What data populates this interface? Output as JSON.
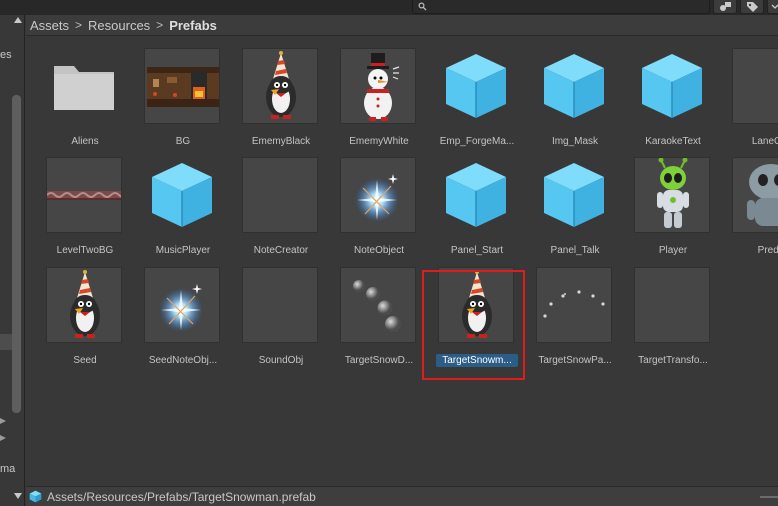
{
  "breadcrumb": {
    "items": [
      "Assets",
      "Resources",
      "Prefabs"
    ],
    "separator": ">"
  },
  "left_pane": {
    "fragments": [
      "es",
      "ma"
    ]
  },
  "assets": [
    {
      "name": "Aliens",
      "kind": "folder"
    },
    {
      "name": "BG",
      "kind": "bg-image"
    },
    {
      "name": "EmemyBlack",
      "kind": "penguin-black"
    },
    {
      "name": "EmemyWhite",
      "kind": "snowman-white"
    },
    {
      "name": "Emp_ForgeMa...",
      "kind": "prefab-cube"
    },
    {
      "name": "Img_Mask",
      "kind": "prefab-cube"
    },
    {
      "name": "KaraokeText",
      "kind": "prefab-cube"
    },
    {
      "name": "LaneCor",
      "kind": "empty"
    },
    {
      "name": "LevelTwoBG",
      "kind": "strip-image"
    },
    {
      "name": "MusicPlayer",
      "kind": "prefab-cube"
    },
    {
      "name": "NoteCreator",
      "kind": "empty"
    },
    {
      "name": "NoteObject",
      "kind": "sparkle"
    },
    {
      "name": "Panel_Start",
      "kind": "prefab-cube"
    },
    {
      "name": "Panel_Talk",
      "kind": "prefab-cube"
    },
    {
      "name": "Player",
      "kind": "alien"
    },
    {
      "name": "Preda",
      "kind": "predator"
    },
    {
      "name": "Seed",
      "kind": "penguin-black"
    },
    {
      "name": "SeedNoteObj...",
      "kind": "sparkle"
    },
    {
      "name": "SoundObj",
      "kind": "empty"
    },
    {
      "name": "TargetSnowD...",
      "kind": "snowballs"
    },
    {
      "name": "TargetSnowm...",
      "kind": "penguin-black",
      "selected": true
    },
    {
      "name": "TargetSnowPa...",
      "kind": "dots"
    },
    {
      "name": "TargetTransfo...",
      "kind": "empty"
    }
  ],
  "status_bar": {
    "path": "Assets/Resources/Prefabs/TargetSnowman.prefab",
    "icon": "prefab-cube-icon"
  },
  "colors": {
    "prefab_cube": "#5ccdf5",
    "selection": "#2c5d87",
    "highlight_box": "#e01c1c"
  }
}
